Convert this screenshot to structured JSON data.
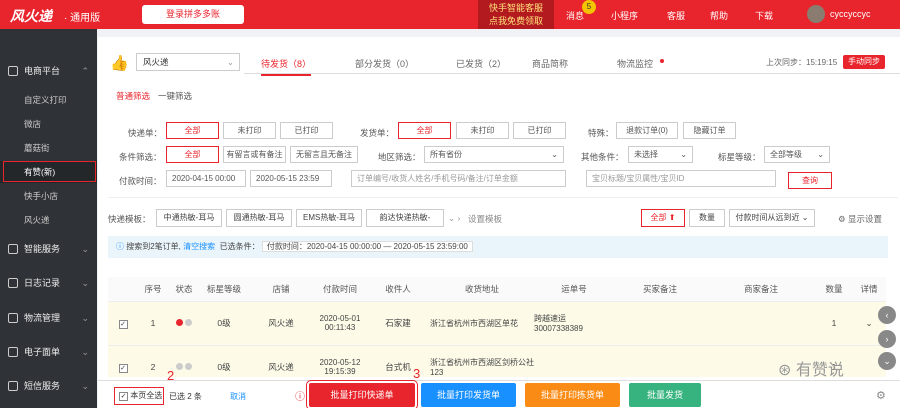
{
  "topbar": {
    "logo": "风火递",
    "edition": "· 通用版",
    "login": "登录拼多多账",
    "promo_line1": "快手智能客服",
    "promo_line2": "点我免费领取",
    "nav": [
      "消息",
      "小程序",
      "客服",
      "帮助",
      "下载"
    ],
    "badge": "5",
    "user": "cyccyccyc"
  },
  "sidebar": {
    "sections": [
      {
        "label": "电商平台"
      },
      {
        "label": "智能服务"
      },
      {
        "label": "日志记录"
      },
      {
        "label": "物流管理"
      },
      {
        "label": "电子面单"
      },
      {
        "label": "短信服务"
      }
    ],
    "items": [
      "自定义打印",
      "微店",
      "蘑菇街",
      "有赞(新)",
      "快手小店",
      "风火递"
    ]
  },
  "annotations": {
    "a1": "1",
    "a2": "2",
    "a3": "3"
  },
  "main": {
    "store": "风火递",
    "tabs": [
      "待发货（8）",
      "部分发货（0）",
      "已发货（2）",
      "商品简称",
      "物流监控"
    ],
    "sync_label": "上次同步：15:19:15",
    "sync_btn": "手动同步",
    "subtabs": [
      "普通筛选",
      "一键筛选"
    ]
  },
  "filters": {
    "express_label": "快递单：",
    "express_opts": [
      "全部",
      "未打印",
      "已打印"
    ],
    "delivery_label": "发货单：",
    "delivery_opts": [
      "全部",
      "未打印",
      "已打印"
    ],
    "special_label": "特殊：",
    "special_opts": [
      "退款订单(0)",
      "隐藏订单"
    ],
    "cond_label": "条件筛选：",
    "cond_opts": [
      "全部",
      "有留言或有备注",
      "无留言且无备注"
    ],
    "region_label": "地区筛选：",
    "region_value": "所有省份",
    "other_label": "其他条件：",
    "other_value": "未选择",
    "flag_label": "标星等级：",
    "flag_value": "全部等级",
    "time_label": "付款时间：",
    "time_from": "2020-04-15 00:00",
    "time_to": "2020-05-15 23:59",
    "order_placeholder": "订单编号/收货人姓名/手机号码/备注/订单金额",
    "goods_placeholder": "宝贝标题/宝贝属性/宝贝ID",
    "search": "查询"
  },
  "templates": {
    "label": "快递模板：",
    "items": [
      "中通热敏-耳马",
      "圆通热敏-耳马",
      "EMS热敏-耳马",
      "韵达快递热敏-"
    ],
    "settings": "设置模板",
    "sort_all": "全部",
    "sort_qty": "数量",
    "sort_time": "付款时间从远到近",
    "show_settings": "显示设置"
  },
  "info": {
    "found": "搜索到2笔订单,",
    "clear": "清空搜索",
    "conditions": "已选条件：",
    "range": "付款时间：2020-04-15 00:00:00 — 2020-05-15 23:59:00"
  },
  "table": {
    "headers": [
      "",
      "序号",
      "状态",
      "标星等级",
      "店铺",
      "付款时间",
      "收件人",
      "收货地址",
      "运单号",
      "买家备注",
      "商家备注",
      "数量",
      "详情"
    ],
    "rows": [
      {
        "idx": "1",
        "level": "0级",
        "shop": "风火递",
        "time": "2020-05-01 00:11:43",
        "name": "石家建",
        "addr": "浙江省杭州市西湖区单花",
        "waybill": "跨越速运 30007338389",
        "qty": "1"
      },
      {
        "idx": "2",
        "level": "0级",
        "shop": "风火递",
        "time": "2020-05-12 19:15:39",
        "name": "台式机",
        "addr": "浙江省杭州市西湖区剑桥公社123",
        "waybill": "",
        "qty": "1"
      }
    ]
  },
  "bottom": {
    "select_page": "本页全选",
    "selected": "已选 2 条",
    "cancel": "取消",
    "print_express": "批量打印快递单",
    "print_delivery": "批量打印发货单",
    "print_pick": "批量打印拣货单",
    "ship": "批量发货"
  },
  "watermark": "有赞说",
  "colors": {
    "brand": "#e8242c",
    "blue": "#1890ff",
    "orange": "#fa8c16",
    "green": "#36b37e"
  }
}
